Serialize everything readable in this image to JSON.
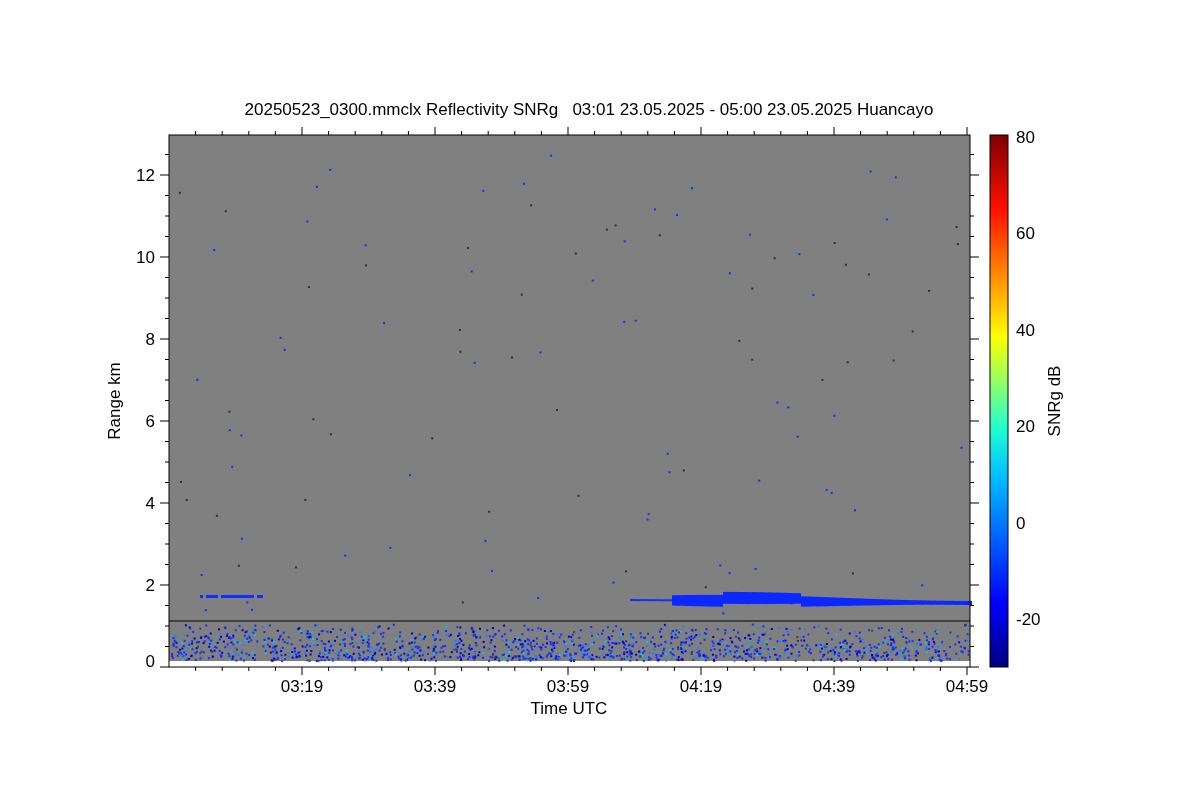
{
  "title": "20250523_0300.mmclx Reflectivity SNRg   03:01 23.05.2025 - 05:00 23.05.2025 Huancayo",
  "x_axis": {
    "label": "Time UTC",
    "ticks": [
      "03:19",
      "03:39",
      "03:59",
      "04:19",
      "04:39",
      "04:59"
    ]
  },
  "y_axis": {
    "label": "Range km",
    "ticks": [
      "12",
      "10",
      "8",
      "6",
      "4",
      "2",
      "0"
    ]
  },
  "colorbar": {
    "label": "SNRg dB",
    "ticks": [
      "80",
      "60",
      "40",
      "20",
      "0",
      "-20"
    ]
  }
}
